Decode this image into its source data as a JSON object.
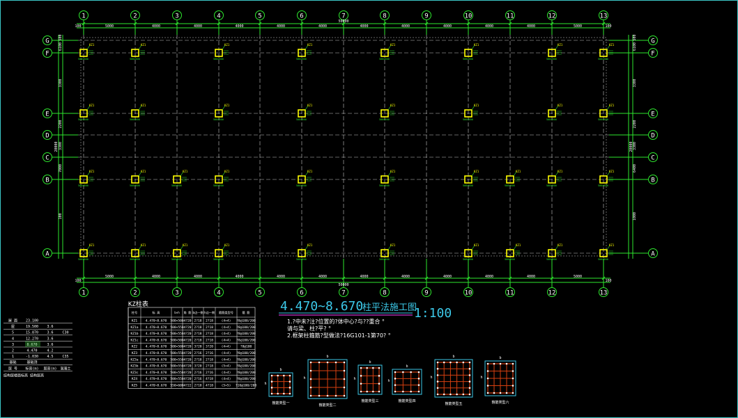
{
  "plan": {
    "col_labels": [
      "1",
      "2",
      "3",
      "4",
      "5",
      "6",
      "7",
      "8",
      "9",
      "10",
      "11",
      "12",
      "13"
    ],
    "row_labels": [
      "G",
      "F",
      "E",
      "D",
      "C",
      "B",
      "A"
    ],
    "top_spans": [
      "5000",
      "4000",
      "4000",
      "4000",
      "4000",
      "4000",
      "4000",
      "4000",
      "4000",
      "4000",
      "4000",
      "5000"
    ],
    "top_total": "50000",
    "bottom_spans": [
      "5000",
      "4000",
      "4000",
      "4000",
      "4000",
      "4000",
      "4000",
      "4000",
      "4000",
      "4000",
      "4000",
      "5000"
    ],
    "bottom_total": "50000",
    "edge_dim": "100",
    "left_spans": [
      "500",
      "6100",
      "3300",
      "2200",
      "3300",
      "7000",
      "100"
    ],
    "left_total": "20000",
    "right_spans": [
      "500",
      "6100",
      "3300",
      "2200",
      "3300",
      "6400",
      "1000"
    ],
    "right_total": "20000",
    "col_tag": "KZ1",
    "col_size": "500x500"
  },
  "title": {
    "main": "4.470~8.670",
    "cn": "柱平法施工图",
    "scale": "1:100"
  },
  "notes": [
    "1.?中未?注?位置的?体中心?与??重合 °",
    "  请与梁、柱?平? °",
    "2.框架柱箍筋?型做法?16G101-1第70? °"
  ],
  "floor_table": {
    "header": [
      "屋 面",
      "23.100",
      "",
      ""
    ],
    "rows": [
      [
        "屋",
        "19.500",
        "3.6",
        ""
      ],
      [
        "5",
        "15.870",
        "3.6",
        "C30"
      ],
      [
        "4",
        "12.270",
        "3.6",
        ""
      ],
      [
        "3",
        "8.670",
        "3.6",
        ""
      ],
      [
        "2",
        "4.470",
        "4.2",
        ""
      ],
      [
        "1",
        "-1.030",
        "4.5",
        "C35"
      ],
      [
        "基础",
        "基础顶",
        "",
        ""
      ],
      [
        "层 号",
        "标高(m)",
        "层高(m)",
        "混凝土"
      ]
    ],
    "footer": "结构层楼面标高  结构层高"
  },
  "kz_table": {
    "caption": "KZ柱表",
    "headers": [
      "柱号",
      "标 高",
      "b×h",
      "角 筋",
      "b边一侧",
      "h边一侧",
      "箍筋类型号",
      "箍 筋"
    ],
    "rows": [
      [
        "KZ1",
        "4.470~8.670",
        "500×500",
        "4?20",
        "2?18",
        "2?18",
        "(4×4)",
        "?8@100/200"
      ],
      [
        "KZ1a",
        "4.470~8.670",
        "500×550",
        "4?20",
        "2?18",
        "2?18",
        "(4×4)",
        "?8@100/200"
      ],
      [
        "KZ1b",
        "4.470~8.670",
        "500×550",
        "4?20",
        "2?18",
        "2?18",
        "(4×4)",
        "?8@100/200"
      ],
      [
        "KZ1c",
        "4.470~8.670",
        "500×500",
        "4?20",
        "2?18",
        "2?18",
        "(4×4)",
        "?8@100/200"
      ],
      [
        "KZ2",
        "4.470~8.670",
        "500×500",
        "4?20",
        "3?20",
        "3?20",
        "(4×4)",
        "?8@100"
      ],
      [
        "KZ3",
        "4.470~8.670",
        "500×550",
        "4?20",
        "2?16",
        "2?16",
        "(4×4)",
        "?8@100/200"
      ],
      [
        "KZ3a",
        "4.470~8.670",
        "500×550",
        "4?20",
        "2?18",
        "2?18",
        "(4×4)",
        "?8@100/200"
      ],
      [
        "KZ3b",
        "4.470~8.670",
        "500×550",
        "4?20",
        "3?20",
        "2?18",
        "(5×4)",
        "?8@100/200"
      ],
      [
        "KZ3c",
        "4.470~8.670",
        "500×550",
        "4?20",
        "2?16",
        "2?16",
        "(4×4)",
        "?8@100/200"
      ],
      [
        "KZ4",
        "4.470~8.670",
        "500×550",
        "4?20",
        "2?16",
        "4?18",
        "(4×4)",
        "?8@100/200"
      ],
      [
        "KZ5",
        "4.470~8.670",
        "550×600",
        "4?22",
        "2?18",
        "4?18",
        "(5×5)",
        "?10@100/200"
      ]
    ]
  },
  "details": [
    {
      "caption": "箍筋类型一"
    },
    {
      "caption": "箍筋类型二"
    },
    {
      "caption": "箍筋类型三"
    },
    {
      "caption": "箍筋类型四"
    },
    {
      "caption": "箍筋类型五"
    },
    {
      "caption": "箍筋类型六"
    }
  ],
  "colors": {
    "grid": "#2ee82e",
    "axis": "#c8c8c8",
    "column": "#ffff00",
    "bubble_text": "#ffffff",
    "title": "#3cc8e8",
    "rebar": "#d84010",
    "table": "#ffffff",
    "magenta": "#ff40ff"
  }
}
